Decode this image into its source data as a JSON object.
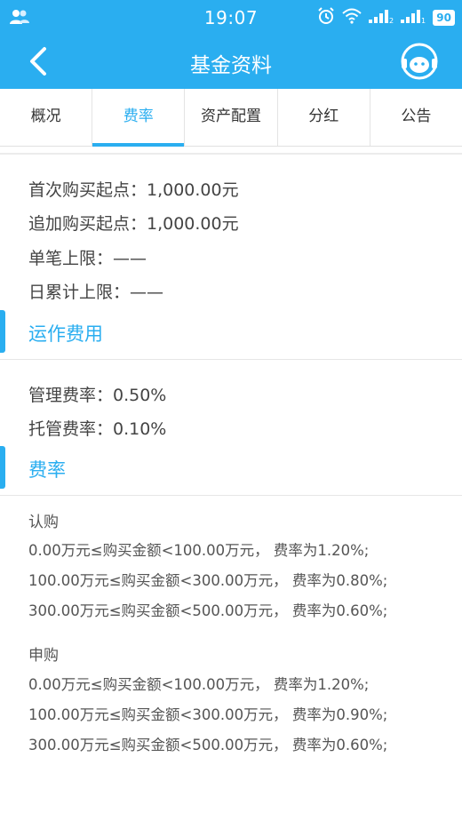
{
  "status": {
    "time": "19:07",
    "battery": "90"
  },
  "nav": {
    "title": "基金资料"
  },
  "tabs": [
    {
      "label": "概况"
    },
    {
      "label": "费率"
    },
    {
      "label": "资产配置"
    },
    {
      "label": "分红"
    },
    {
      "label": "公告"
    }
  ],
  "limits": {
    "first_purchase": "首次购买起点：1,000.00元",
    "additional_purchase": "追加购买起点：1,000.00元",
    "single_limit": "单笔上限：——",
    "daily_limit": "日累计上限：——"
  },
  "operating": {
    "title": "运作费用",
    "management_fee": "管理费率：0.50%",
    "custody_fee": "托管费率：0.10%"
  },
  "rates": {
    "title": "费率",
    "subscription": {
      "label": "认购",
      "lines": [
        "0.00万元≤购买金额<100.00万元，  费率为1.20%;",
        "100.00万元≤购买金额<300.00万元，  费率为0.80%;",
        "300.00万元≤购买金额<500.00万元，  费率为0.60%;"
      ]
    },
    "purchase": {
      "label": "申购",
      "lines": [
        "0.00万元≤购买金额<100.00万元，  费率为1.20%;",
        "100.00万元≤购买金额<300.00万元，  费率为0.90%;",
        "300.00万元≤购买金额<500.00万元，  费率为0.60%;"
      ]
    }
  },
  "colors": {
    "accent": "#2aaef0",
    "text": "#444444",
    "divider": "#e6e6e6"
  }
}
